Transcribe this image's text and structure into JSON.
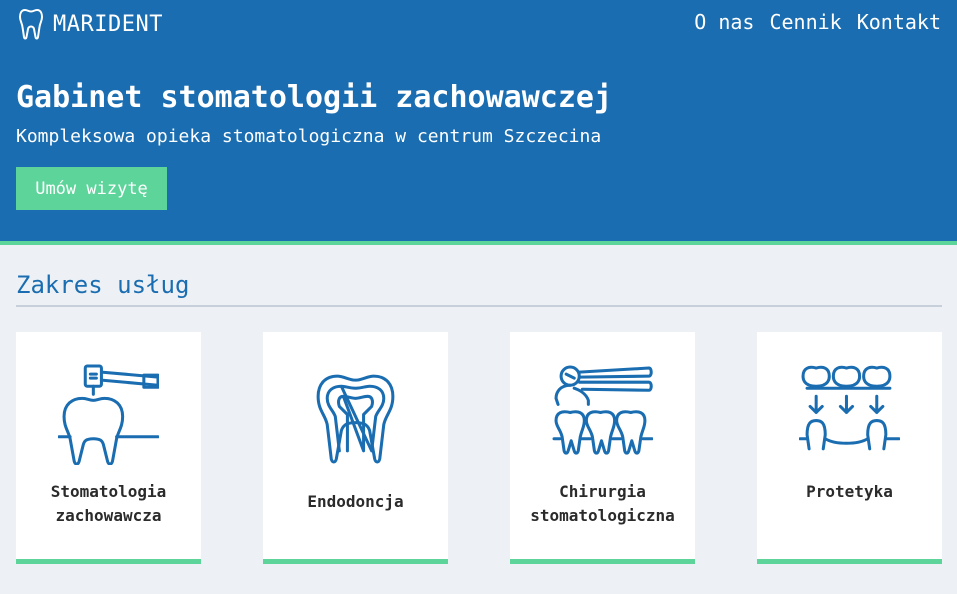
{
  "brand": {
    "name": "MARIDENT"
  },
  "nav": {
    "items": [
      "O nas",
      "Cennik",
      "Kontakt"
    ]
  },
  "hero": {
    "title": "Gabinet stomatologii zachowawczej",
    "subtitle": "Kompleksowa opieka stomatologiczna w centrum Szczecina",
    "cta_label": "Umów wizytę"
  },
  "services": {
    "title": "Zakres usług",
    "items": [
      {
        "lines": [
          "Stomatologia",
          "zachowawcza"
        ],
        "icon": "tooth-drill-icon"
      },
      {
        "lines": [
          "Endodoncja"
        ],
        "icon": "tooth-root-icon"
      },
      {
        "lines": [
          "Chirurgia",
          "stomatologiczna"
        ],
        "icon": "tooth-extraction-icon"
      },
      {
        "lines": [
          "Protetyka"
        ],
        "icon": "dental-bridge-icon"
      }
    ]
  },
  "colors": {
    "primary": "#1a6db0",
    "accent": "#5dd49a",
    "background": "#edf1f5"
  }
}
